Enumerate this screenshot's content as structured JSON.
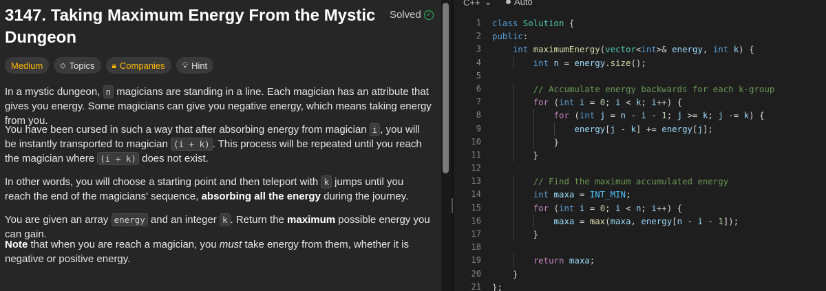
{
  "problem": {
    "title": "3147. Taking Maximum Energy From the Mystic Dungeon",
    "status": "Solved",
    "tags": [
      "Medium",
      "Topics",
      "Companies",
      "Hint"
    ],
    "paragraphs": [
      [
        {
          "t": "text",
          "v": "In a mystic dungeon, "
        },
        {
          "t": "code",
          "v": "n"
        },
        {
          "t": "text",
          "v": " magicians are standing in a line. Each magician has an attribute that gives you energy. Some magicians can give you negative energy, which means taking energy from you."
        }
      ],
      [
        {
          "t": "text",
          "v": "You have been cursed in such a way that after absorbing energy from magician "
        },
        {
          "t": "code",
          "v": "i"
        },
        {
          "t": "text",
          "v": ", you will be instantly transported to magician "
        },
        {
          "t": "code",
          "v": "(i + k)"
        },
        {
          "t": "text",
          "v": ". This process will be repeated until you reach the magician where "
        },
        {
          "t": "code",
          "v": "(i + k)"
        },
        {
          "t": "text",
          "v": " does not exist."
        }
      ],
      [
        {
          "t": "text",
          "v": "In other words, you will choose a starting point and then teleport with "
        },
        {
          "t": "code",
          "v": "k"
        },
        {
          "t": "text",
          "v": " jumps until you reach the end of the magicians' sequence, "
        },
        {
          "t": "bold",
          "v": "absorbing all the energy"
        },
        {
          "t": "text",
          "v": " during the journey."
        }
      ],
      [
        {
          "t": "text",
          "v": "You are given an array "
        },
        {
          "t": "code",
          "v": "energy"
        },
        {
          "t": "text",
          "v": " and an integer "
        },
        {
          "t": "code",
          "v": "k"
        },
        {
          "t": "text",
          "v": ". Return the "
        },
        {
          "t": "bold",
          "v": "maximum"
        },
        {
          "t": "text",
          "v": " possible energy you can gain."
        }
      ],
      [
        {
          "t": "bold",
          "v": "Note"
        },
        {
          "t": "text",
          "v": " that when you are reach a magician, you "
        },
        {
          "t": "italic",
          "v": "must"
        },
        {
          "t": "text",
          "v": " take energy from them, whether it is negative or positive energy."
        }
      ]
    ]
  },
  "editor": {
    "language": "C++",
    "mode": "Auto",
    "lines": [
      [
        {
          "c": "#569cd6",
          "v": "class "
        },
        {
          "c": "#4ec9b0",
          "v": "Solution"
        },
        {
          "c": "#d4d4d4",
          "v": " {"
        }
      ],
      [
        {
          "c": "#569cd6",
          "v": "public"
        },
        {
          "c": "#d4d4d4",
          "v": ":"
        }
      ],
      [
        {
          "c": "#d4d4d4",
          "v": "    "
        },
        {
          "c": "#569cd6",
          "v": "int "
        },
        {
          "c": "#dcdcaa",
          "v": "maximumEnergy"
        },
        {
          "c": "#d4d4d4",
          "v": "("
        },
        {
          "c": "#4ec9b0",
          "v": "vector"
        },
        {
          "c": "#d4d4d4",
          "v": "<"
        },
        {
          "c": "#569cd6",
          "v": "int"
        },
        {
          "c": "#d4d4d4",
          "v": ">& "
        },
        {
          "c": "#9cdcfe",
          "v": "energy"
        },
        {
          "c": "#d4d4d4",
          "v": ", "
        },
        {
          "c": "#569cd6",
          "v": "int "
        },
        {
          "c": "#9cdcfe",
          "v": "k"
        },
        {
          "c": "#d4d4d4",
          "v": ") {"
        }
      ],
      [
        {
          "c": "#d4d4d4",
          "v": "        "
        },
        {
          "c": "#569cd6",
          "v": "int "
        },
        {
          "c": "#9cdcfe",
          "v": "n"
        },
        {
          "c": "#d4d4d4",
          "v": " = "
        },
        {
          "c": "#9cdcfe",
          "v": "energy"
        },
        {
          "c": "#d4d4d4",
          "v": "."
        },
        {
          "c": "#dcdcaa",
          "v": "size"
        },
        {
          "c": "#d4d4d4",
          "v": "();"
        }
      ],
      [],
      [
        {
          "c": "#d4d4d4",
          "v": "        "
        },
        {
          "c": "#6a9955",
          "v": "// Accumulate energy backwards for each k-group"
        }
      ],
      [
        {
          "c": "#d4d4d4",
          "v": "        "
        },
        {
          "c": "#c586c0",
          "v": "for"
        },
        {
          "c": "#d4d4d4",
          "v": " ("
        },
        {
          "c": "#569cd6",
          "v": "int "
        },
        {
          "c": "#9cdcfe",
          "v": "i"
        },
        {
          "c": "#d4d4d4",
          "v": " = "
        },
        {
          "c": "#b5cea8",
          "v": "0"
        },
        {
          "c": "#d4d4d4",
          "v": "; "
        },
        {
          "c": "#9cdcfe",
          "v": "i"
        },
        {
          "c": "#d4d4d4",
          "v": " < "
        },
        {
          "c": "#9cdcfe",
          "v": "k"
        },
        {
          "c": "#d4d4d4",
          "v": "; "
        },
        {
          "c": "#9cdcfe",
          "v": "i"
        },
        {
          "c": "#d4d4d4",
          "v": "++) {"
        }
      ],
      [
        {
          "c": "#d4d4d4",
          "v": "            "
        },
        {
          "c": "#c586c0",
          "v": "for"
        },
        {
          "c": "#d4d4d4",
          "v": " ("
        },
        {
          "c": "#569cd6",
          "v": "int "
        },
        {
          "c": "#9cdcfe",
          "v": "j"
        },
        {
          "c": "#d4d4d4",
          "v": " = "
        },
        {
          "c": "#9cdcfe",
          "v": "n"
        },
        {
          "c": "#d4d4d4",
          "v": " - "
        },
        {
          "c": "#9cdcfe",
          "v": "i"
        },
        {
          "c": "#d4d4d4",
          "v": " - "
        },
        {
          "c": "#b5cea8",
          "v": "1"
        },
        {
          "c": "#d4d4d4",
          "v": "; "
        },
        {
          "c": "#9cdcfe",
          "v": "j"
        },
        {
          "c": "#d4d4d4",
          "v": " >= "
        },
        {
          "c": "#9cdcfe",
          "v": "k"
        },
        {
          "c": "#d4d4d4",
          "v": "; "
        },
        {
          "c": "#9cdcfe",
          "v": "j"
        },
        {
          "c": "#d4d4d4",
          "v": " -= "
        },
        {
          "c": "#9cdcfe",
          "v": "k"
        },
        {
          "c": "#d4d4d4",
          "v": ") {"
        }
      ],
      [
        {
          "c": "#d4d4d4",
          "v": "                "
        },
        {
          "c": "#9cdcfe",
          "v": "energy"
        },
        {
          "c": "#d4d4d4",
          "v": "["
        },
        {
          "c": "#9cdcfe",
          "v": "j"
        },
        {
          "c": "#d4d4d4",
          "v": " - "
        },
        {
          "c": "#9cdcfe",
          "v": "k"
        },
        {
          "c": "#d4d4d4",
          "v": "] += "
        },
        {
          "c": "#9cdcfe",
          "v": "energy"
        },
        {
          "c": "#d4d4d4",
          "v": "["
        },
        {
          "c": "#9cdcfe",
          "v": "j"
        },
        {
          "c": "#d4d4d4",
          "v": "];"
        }
      ],
      [
        {
          "c": "#d4d4d4",
          "v": "            }"
        }
      ],
      [
        {
          "c": "#d4d4d4",
          "v": "        }"
        }
      ],
      [],
      [
        {
          "c": "#d4d4d4",
          "v": "        "
        },
        {
          "c": "#6a9955",
          "v": "// Find the maximum accumulated energy"
        }
      ],
      [
        {
          "c": "#d4d4d4",
          "v": "        "
        },
        {
          "c": "#569cd6",
          "v": "int "
        },
        {
          "c": "#9cdcfe",
          "v": "maxa"
        },
        {
          "c": "#d4d4d4",
          "v": " = "
        },
        {
          "c": "#4fc1ff",
          "v": "INT_MIN"
        },
        {
          "c": "#d4d4d4",
          "v": ";"
        }
      ],
      [
        {
          "c": "#d4d4d4",
          "v": "        "
        },
        {
          "c": "#c586c0",
          "v": "for"
        },
        {
          "c": "#d4d4d4",
          "v": " ("
        },
        {
          "c": "#569cd6",
          "v": "int "
        },
        {
          "c": "#9cdcfe",
          "v": "i"
        },
        {
          "c": "#d4d4d4",
          "v": " = "
        },
        {
          "c": "#b5cea8",
          "v": "0"
        },
        {
          "c": "#d4d4d4",
          "v": "; "
        },
        {
          "c": "#9cdcfe",
          "v": "i"
        },
        {
          "c": "#d4d4d4",
          "v": " < "
        },
        {
          "c": "#9cdcfe",
          "v": "n"
        },
        {
          "c": "#d4d4d4",
          "v": "; "
        },
        {
          "c": "#9cdcfe",
          "v": "i"
        },
        {
          "c": "#d4d4d4",
          "v": "++) {"
        }
      ],
      [
        {
          "c": "#d4d4d4",
          "v": "            "
        },
        {
          "c": "#9cdcfe",
          "v": "maxa"
        },
        {
          "c": "#d4d4d4",
          "v": " = "
        },
        {
          "c": "#dcdcaa",
          "v": "max"
        },
        {
          "c": "#d4d4d4",
          "v": "("
        },
        {
          "c": "#9cdcfe",
          "v": "maxa"
        },
        {
          "c": "#d4d4d4",
          "v": ", "
        },
        {
          "c": "#9cdcfe",
          "v": "energy"
        },
        {
          "c": "#d4d4d4",
          "v": "["
        },
        {
          "c": "#9cdcfe",
          "v": "n"
        },
        {
          "c": "#d4d4d4",
          "v": " - "
        },
        {
          "c": "#9cdcfe",
          "v": "i"
        },
        {
          "c": "#d4d4d4",
          "v": " - "
        },
        {
          "c": "#b5cea8",
          "v": "1"
        },
        {
          "c": "#d4d4d4",
          "v": "]);"
        }
      ],
      [
        {
          "c": "#d4d4d4",
          "v": "        }"
        }
      ],
      [],
      [
        {
          "c": "#d4d4d4",
          "v": "        "
        },
        {
          "c": "#c586c0",
          "v": "return "
        },
        {
          "c": "#9cdcfe",
          "v": "maxa"
        },
        {
          "c": "#d4d4d4",
          "v": ";"
        }
      ],
      [
        {
          "c": "#d4d4d4",
          "v": "    }"
        }
      ],
      [
        {
          "c": "#d4d4d4",
          "v": "};"
        }
      ]
    ]
  },
  "colors": {
    "medium": "#ffb800",
    "solved": "#2cbb5d",
    "panel_bg": "#262626",
    "editor_bg": "#1e1e1e"
  }
}
